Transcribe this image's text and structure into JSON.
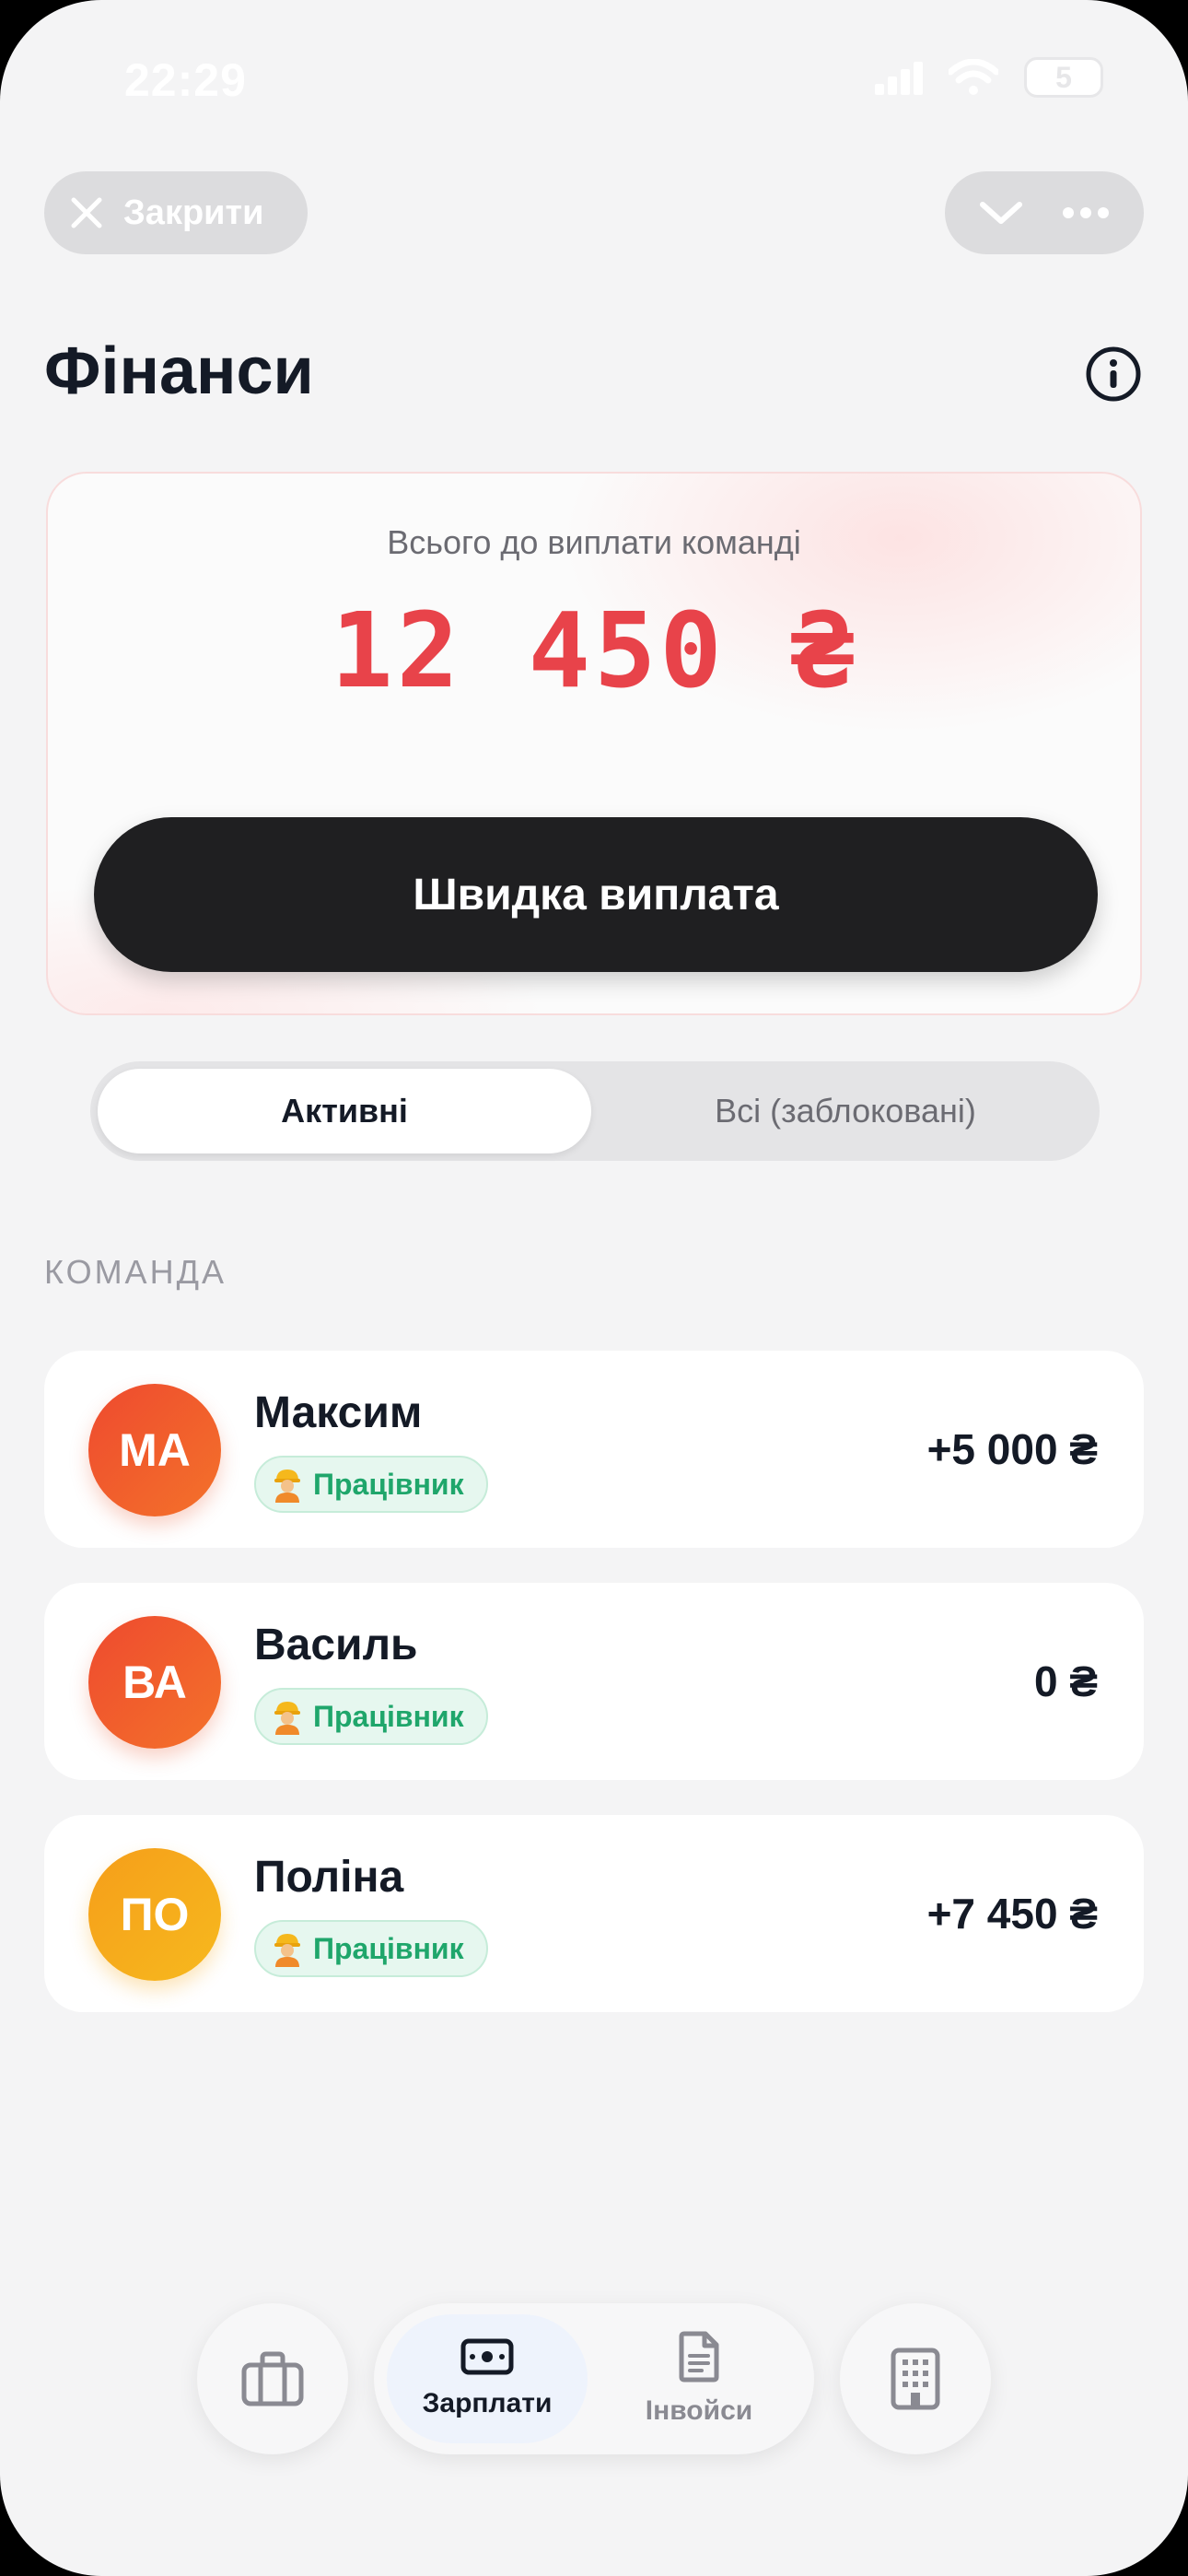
{
  "status_bar": {
    "time": "22:29",
    "battery": "5"
  },
  "header": {
    "close_label": "Закрити",
    "title": "Фінанси"
  },
  "summary": {
    "label": "Всього до виплати команді",
    "amount": "12 450 ₴",
    "quick_pay_label": "Швидка виплата"
  },
  "filter": {
    "active_label": "Активні",
    "all_label": "Всі (заблоковані)"
  },
  "team": {
    "section_label": "КОМАНДА",
    "members": [
      {
        "initials": "МА",
        "name": "Максим",
        "role": "Працівник",
        "amount": "+5 000 ₴"
      },
      {
        "initials": "ВА",
        "name": "Василь",
        "role": "Працівник",
        "amount": "0 ₴"
      },
      {
        "initials": "ПО",
        "name": "Поліна",
        "role": "Працівник",
        "amount": "+7 450 ₴"
      }
    ]
  },
  "bottom_nav": {
    "items": [
      {
        "icon": "briefcase-icon",
        "label": ""
      },
      {
        "icon": "cash-icon",
        "label": "Зарплати"
      },
      {
        "icon": "document-icon",
        "label": "Інвойси"
      },
      {
        "icon": "building-icon",
        "label": ""
      }
    ]
  },
  "colors": {
    "accent_red": "#e8434a",
    "dark_button": "#1f1f21",
    "role_green": "#1fa66b",
    "avatar_orange": "#f15a2a",
    "avatar_yellow": "#f7b11c"
  }
}
